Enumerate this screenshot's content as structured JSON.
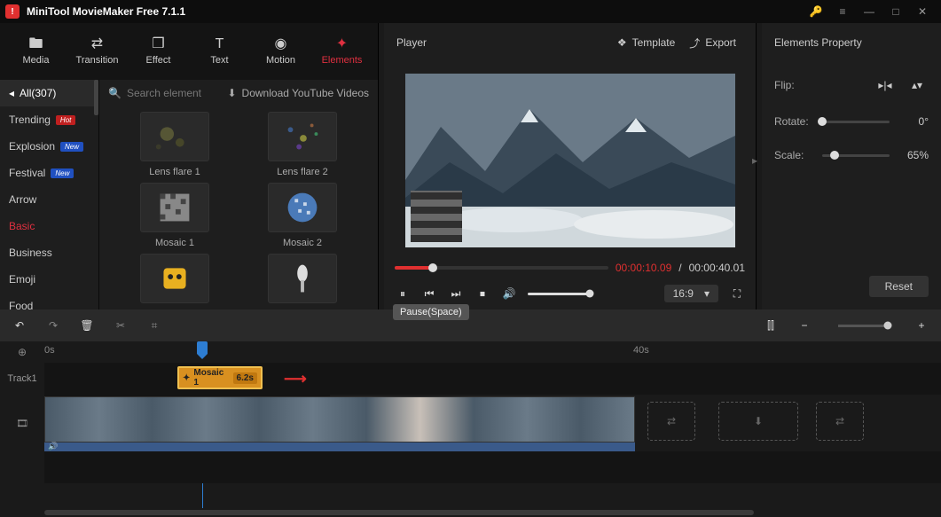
{
  "app": {
    "title": "MiniTool MovieMaker Free 7.1.1"
  },
  "tabs": [
    {
      "label": "Media",
      "icon": "folder"
    },
    {
      "label": "Transition",
      "icon": "swap"
    },
    {
      "label": "Effect",
      "icon": "layers"
    },
    {
      "label": "Text",
      "icon": "text"
    },
    {
      "label": "Motion",
      "icon": "motion"
    },
    {
      "label": "Elements",
      "icon": "star"
    }
  ],
  "sidebar": {
    "all_label": "All(307)",
    "items": [
      {
        "label": "Trending",
        "badge": "Hot",
        "badgeClass": "hot"
      },
      {
        "label": "Explosion",
        "badge": "New",
        "badgeClass": "new"
      },
      {
        "label": "Festival",
        "badge": "New",
        "badgeClass": "new"
      },
      {
        "label": "Arrow"
      },
      {
        "label": "Basic",
        "active": true
      },
      {
        "label": "Business"
      },
      {
        "label": "Emoji"
      },
      {
        "label": "Food"
      }
    ]
  },
  "grid": {
    "search_placeholder": "Search element",
    "yt_label": "Download YouTube Videos",
    "cells": [
      {
        "label": "Lens flare 1"
      },
      {
        "label": "Lens flare 2"
      },
      {
        "label": "Mosaic 1"
      },
      {
        "label": "Mosaic 2"
      },
      {
        "label": ""
      },
      {
        "label": ""
      }
    ]
  },
  "player": {
    "title": "Player",
    "template_label": "Template",
    "export_label": "Export",
    "current_time": "00:00:10.09",
    "duration": "00:00:40.01",
    "aspect": "16:9",
    "pause_tooltip": "Pause(Space)"
  },
  "props": {
    "title": "Elements Property",
    "flip_label": "Flip:",
    "rotate_label": "Rotate:",
    "rotate_value": "0°",
    "scale_label": "Scale:",
    "scale_value": "65%",
    "reset_label": "Reset"
  },
  "timeline": {
    "ruler": {
      "t0": "0s",
      "t40": "40s"
    },
    "track1_label": "Track1",
    "element_clip": {
      "name": "Mosaic 1",
      "duration": "6.2s"
    }
  }
}
